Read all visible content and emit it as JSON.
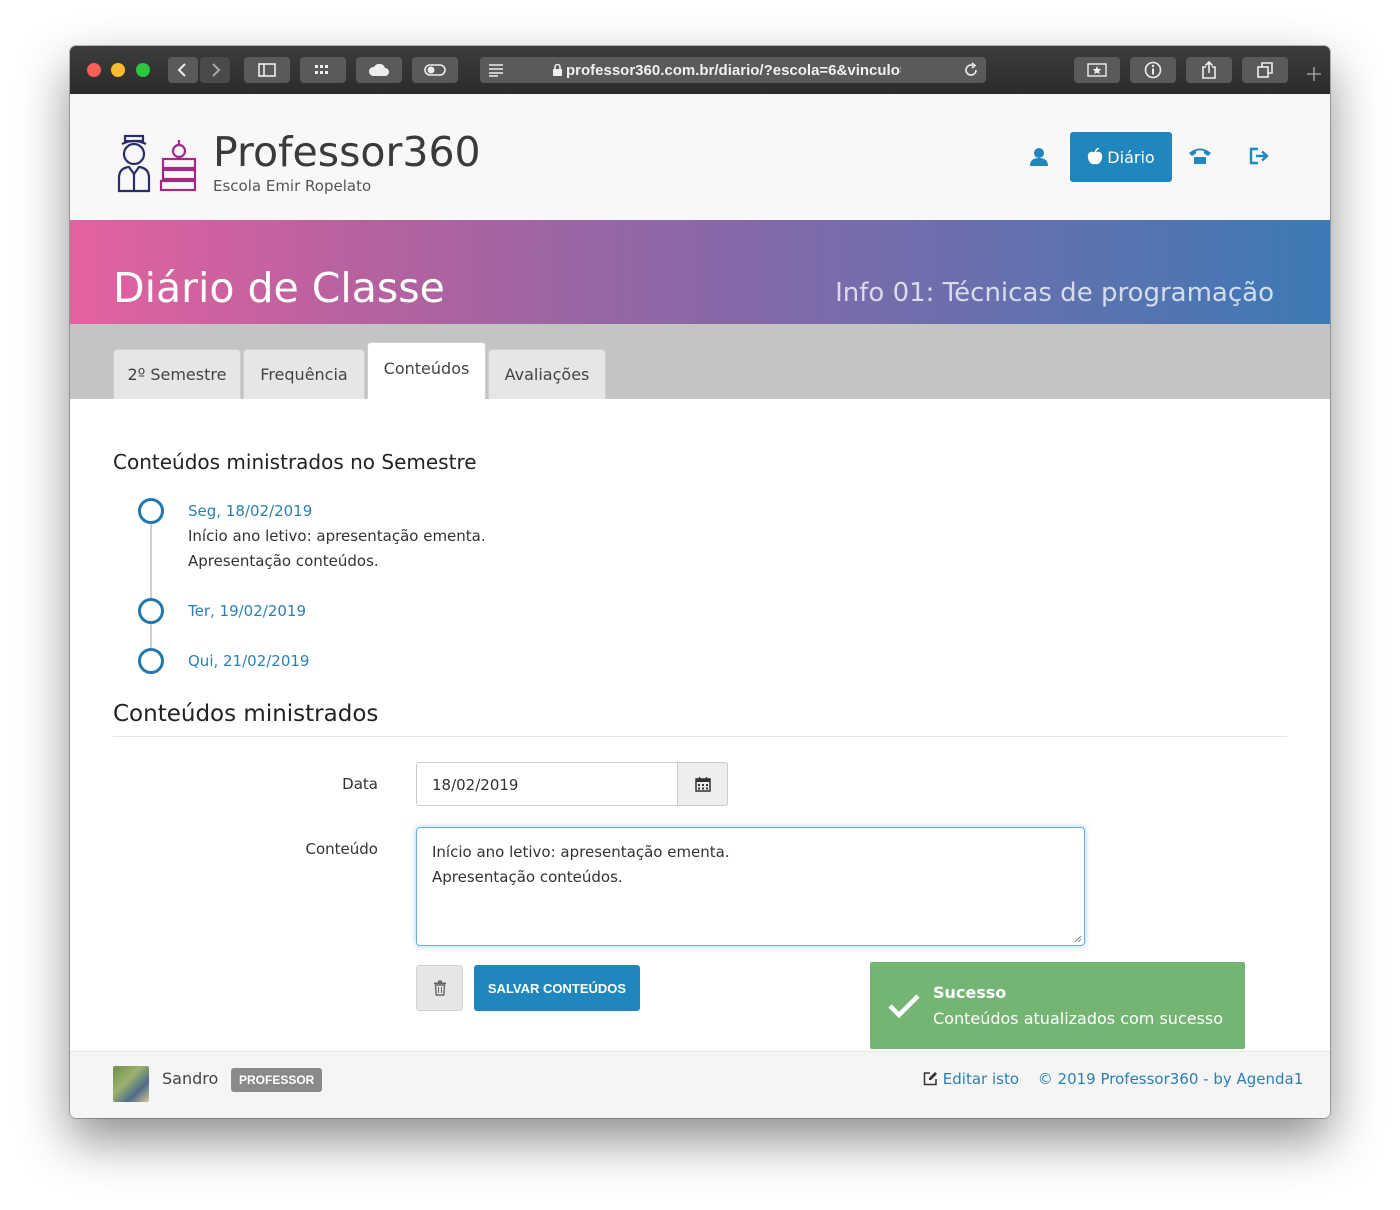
{
  "browser": {
    "url": "professor360.com.br/diario/?escola=6&vinculo=",
    "lights": {
      "close": "#fc5f57",
      "minimize": "#fdbc2e",
      "zoom": "#29c840"
    }
  },
  "header": {
    "brand": "Professor360",
    "school": "Escola Emir Ropelato",
    "nav_diario_label": "Diário",
    "accent": "#1f87bd"
  },
  "banner": {
    "title": "Diário de Classe",
    "course": "Info 01: Técnicas de programação"
  },
  "tabs": [
    {
      "label": "2º Semestre",
      "active": false
    },
    {
      "label": "Frequência",
      "active": false
    },
    {
      "label": "Conteúdos",
      "active": true
    },
    {
      "label": "Avaliações",
      "active": false
    }
  ],
  "semester_section": {
    "title": "Conteúdos ministrados no Semestre",
    "items": [
      {
        "date": "Seg, 18/02/2019",
        "lines": [
          "Início ano letivo: apresentação ementa.",
          "Apresentação conteúdos."
        ]
      },
      {
        "date": "Ter, 19/02/2019",
        "lines": []
      },
      {
        "date": "Qui, 21/02/2019",
        "lines": []
      }
    ]
  },
  "form": {
    "title": "Conteúdos ministrados",
    "date_label": "Data",
    "date_value": "18/02/2019",
    "content_label": "Conteúdo",
    "content_lines": [
      "Início ano letivo: apresentação ementa.",
      "Apresentação conteúdos."
    ],
    "save_label": "SALVAR CONTEÚDOS"
  },
  "footer": {
    "user_name": "Sandro",
    "role_badge": "PROFESSOR",
    "edit_link": "Editar isto",
    "copyright": "© 2019 Professor360 - by Agenda1"
  },
  "toast": {
    "title": "Sucesso",
    "message": "Conteúdos atualizados com sucesso",
    "color": "#74b574"
  }
}
